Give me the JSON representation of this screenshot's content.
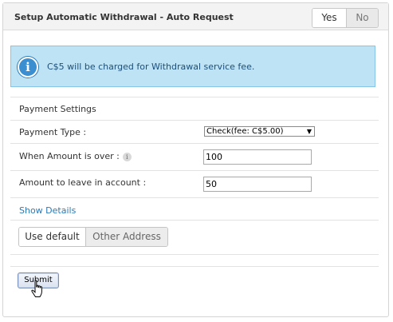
{
  "header": {
    "title": "Setup Automatic Withdrawal - Auto Request",
    "toggle": {
      "yes_label": "Yes",
      "no_label": "No",
      "selected": "Yes"
    }
  },
  "notice": {
    "icon": "info-icon",
    "text": "C$5 will be charged for Withdrawal service fee."
  },
  "payment_settings": {
    "heading": "Payment Settings",
    "payment_type": {
      "label": "Payment Type :",
      "selected": "Check(fee: C$5.00)"
    },
    "when_amount_over": {
      "label": "When Amount is over :",
      "value": "100"
    },
    "amount_to_leave": {
      "label": "Amount to leave in account :",
      "value": "50"
    }
  },
  "show_details_label": "Show Details",
  "address_toggle": {
    "default_label": "Use default",
    "other_label": "Other Address",
    "selected": "Use default"
  },
  "submit_label": "Submit",
  "colors": {
    "notice_bg": "#bde3f4",
    "notice_border": "#86c5e6",
    "link": "#2a7ab8"
  }
}
